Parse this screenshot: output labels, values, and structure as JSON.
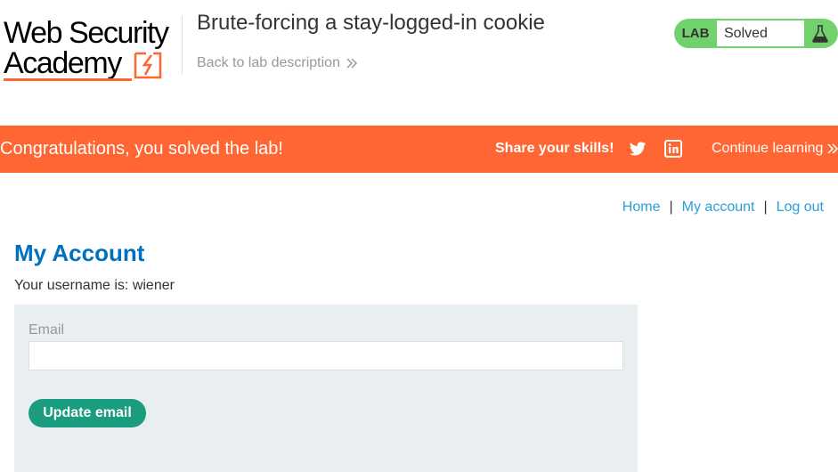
{
  "header": {
    "logo_line1": "Web Security",
    "logo_line2": "Academy",
    "lab_title": "Brute-forcing a stay-logged-in cookie",
    "back_link": "Back to lab description",
    "lab_badge": "LAB",
    "lab_status": "Solved"
  },
  "banner": {
    "congrats": "Congratulations, you solved the lab!",
    "share": "Share your skills!",
    "continue": "Continue learning"
  },
  "nav": {
    "home": "Home",
    "sep1": "|",
    "my_account": "My account",
    "sep2": "|",
    "logout": "Log out"
  },
  "main": {
    "title": "My Account",
    "username_text": "Your username is: wiener",
    "email_label": "Email",
    "email_value": "",
    "update_button": "Update email"
  },
  "colors": {
    "accent_orange": "#ff6633",
    "lab_green": "#70d16d",
    "link_blue": "#29a0d8",
    "title_blue": "#0071bc",
    "button_teal": "#1a9c7f"
  },
  "icons": {
    "logo_mark": "academy-bolt-icon",
    "back_chevron": "double-chevron-right-icon",
    "flask": "flask-icon",
    "twitter": "twitter-icon",
    "linkedin": "linkedin-icon"
  }
}
